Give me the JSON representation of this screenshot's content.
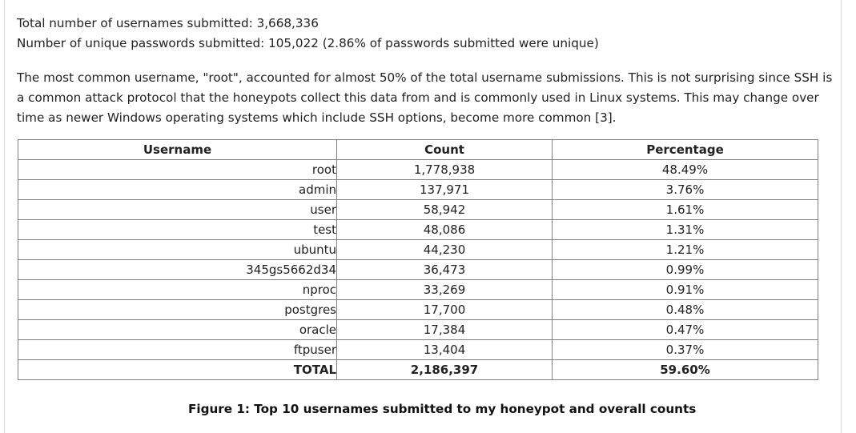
{
  "stats": {
    "usernames_line": "Total number of usernames submitted: 3,668,336",
    "passwords_line": "Number of unique passwords submitted: 105,022 (2.86% of passwords submitted were unique)"
  },
  "paragraph": "The most common username, \"root\", accounted for almost 50% of the total username submissions. This is not surprising since SSH is a common attack protocol that the honeypots collect this data from and is commonly used in Linux systems. This may change over time as newer Windows operating systems which include SSH options, become more common [3].",
  "table": {
    "headers": [
      "Username",
      "Count",
      "Percentage"
    ],
    "rows": [
      [
        "root",
        "1,778,938",
        "48.49%"
      ],
      [
        "admin",
        "137,971",
        "3.76%"
      ],
      [
        "user",
        "58,942",
        "1.61%"
      ],
      [
        "test",
        "48,086",
        "1.31%"
      ],
      [
        "ubuntu",
        "44,230",
        "1.21%"
      ],
      [
        "345gs5662d34",
        "36,473",
        "0.99%"
      ],
      [
        "nproc",
        "33,269",
        "0.91%"
      ],
      [
        "postgres",
        "17,700",
        "0.48%"
      ],
      [
        "oracle",
        "17,384",
        "0.47%"
      ],
      [
        "ftpuser",
        "13,404",
        "0.37%"
      ]
    ],
    "total": [
      "TOTAL",
      "2,186,397",
      "59.60%"
    ]
  },
  "caption": "Figure 1: Top 10 usernames submitted to my honeypot and overall counts"
}
